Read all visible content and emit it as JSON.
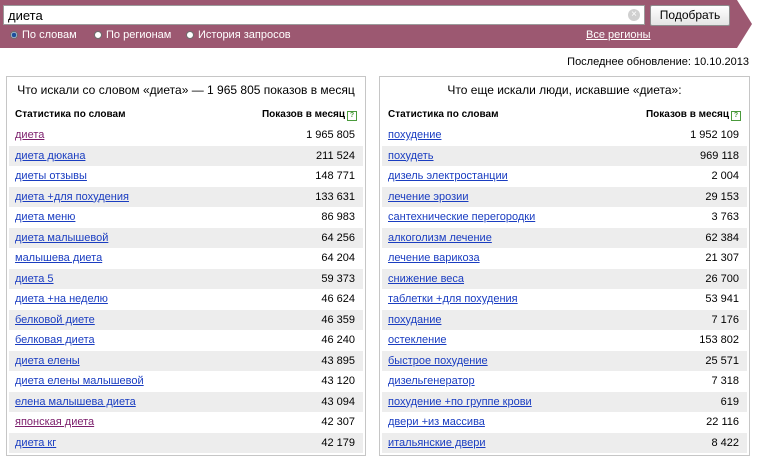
{
  "search": {
    "value": "диета",
    "clear_glyph": "×",
    "button_label": "Подобрать",
    "modes": [
      {
        "label": "По словам",
        "selected": true
      },
      {
        "label": "По регионам",
        "selected": false
      },
      {
        "label": "История запросов",
        "selected": false
      }
    ],
    "regions_link": "Все регионы"
  },
  "last_update": "Последнее обновление: 10.10.2013",
  "colors": {
    "band": "#9c5871",
    "link": "#1a3dc1",
    "visited": "#7b1d6b"
  },
  "left_panel": {
    "title": "Что искали со словом «диета» — 1 965 805 показов в месяц",
    "col_keyword": "Статистика по словам",
    "col_count": "Показов в месяц",
    "help_glyph": "?",
    "rows": [
      {
        "keyword": "диета",
        "count": "1 965 805",
        "visited": true
      },
      {
        "keyword": "диета дюкана",
        "count": "211 524",
        "visited": false
      },
      {
        "keyword": "диеты отзывы",
        "count": "148 771",
        "visited": false
      },
      {
        "keyword": "диета +для похудения",
        "count": "133 631",
        "visited": false
      },
      {
        "keyword": "диета меню",
        "count": "86 983",
        "visited": false
      },
      {
        "keyword": "диета малышевой",
        "count": "64 256",
        "visited": false
      },
      {
        "keyword": "малышева диета",
        "count": "64 204",
        "visited": false
      },
      {
        "keyword": "диета 5",
        "count": "59 373",
        "visited": false
      },
      {
        "keyword": "диета +на неделю",
        "count": "46 624",
        "visited": false
      },
      {
        "keyword": "белковой диете",
        "count": "46 359",
        "visited": false
      },
      {
        "keyword": "белковая диета",
        "count": "46 240",
        "visited": false
      },
      {
        "keyword": "диета елены",
        "count": "43 895",
        "visited": false
      },
      {
        "keyword": "диета елены малышевой",
        "count": "43 120",
        "visited": false
      },
      {
        "keyword": "елена малышева диета",
        "count": "43 094",
        "visited": false
      },
      {
        "keyword": "японская диета",
        "count": "42 307",
        "visited": true
      },
      {
        "keyword": "диета кг",
        "count": "42 179",
        "visited": false
      }
    ]
  },
  "right_panel": {
    "title": "Что еще искали люди, искавшие «диета»:",
    "col_keyword": "Статистика по словам",
    "col_count": "Показов в месяц",
    "help_glyph": "?",
    "rows": [
      {
        "keyword": "похудение",
        "count": "1 952 109",
        "visited": false
      },
      {
        "keyword": "похудеть",
        "count": "969 118",
        "visited": false
      },
      {
        "keyword": "дизель электростанции",
        "count": "2 004",
        "visited": false
      },
      {
        "keyword": "лечение эрозии",
        "count": "29 153",
        "visited": false
      },
      {
        "keyword": "сантехнические перегородки",
        "count": "3 763",
        "visited": false
      },
      {
        "keyword": "алкоголизм лечение",
        "count": "62 384",
        "visited": false
      },
      {
        "keyword": "лечение варикоза",
        "count": "21 307",
        "visited": false
      },
      {
        "keyword": "снижение веса",
        "count": "26 700",
        "visited": false
      },
      {
        "keyword": "таблетки +для похудения",
        "count": "53 941",
        "visited": false
      },
      {
        "keyword": "похудание",
        "count": "7 176",
        "visited": false
      },
      {
        "keyword": "остекление",
        "count": "153 802",
        "visited": false
      },
      {
        "keyword": "быстрое похудение",
        "count": "25 571",
        "visited": false
      },
      {
        "keyword": "дизельгенератор",
        "count": "7 318",
        "visited": false
      },
      {
        "keyword": "похудение +по группе крови",
        "count": "619",
        "visited": false
      },
      {
        "keyword": "двери +из массива",
        "count": "22 116",
        "visited": false
      },
      {
        "keyword": "итальянские двери",
        "count": "8 422",
        "visited": false
      }
    ]
  }
}
